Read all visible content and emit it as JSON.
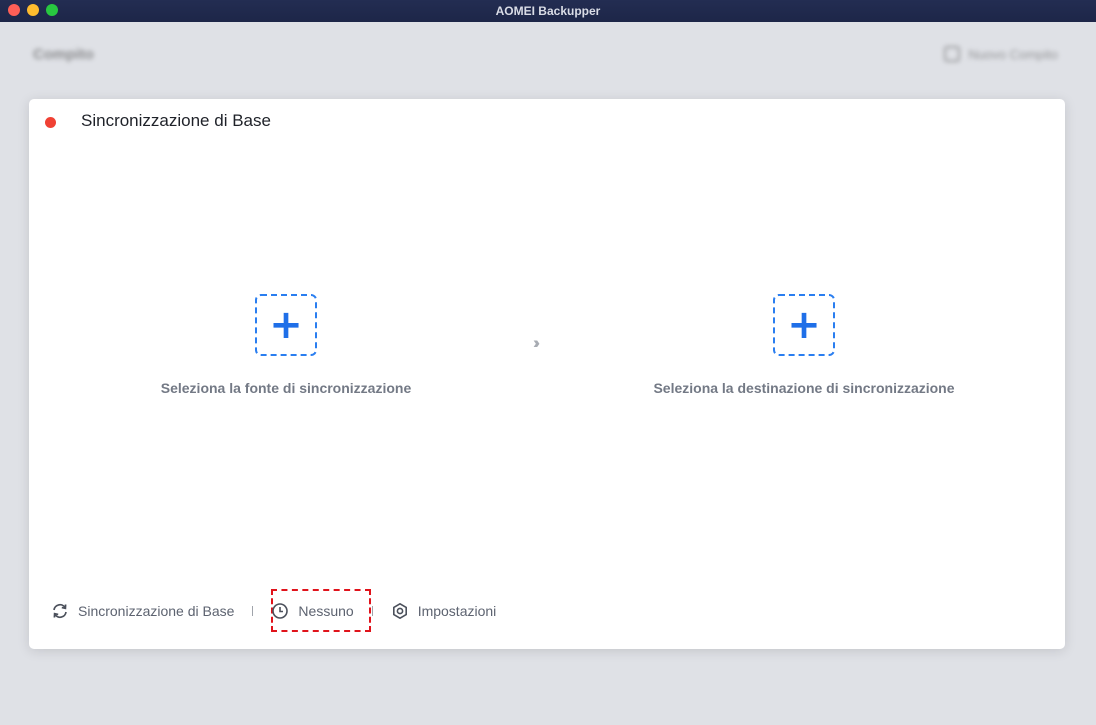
{
  "window": {
    "title": "AOMEI Backupper"
  },
  "background": {
    "page_title": "Compito",
    "reset_label": "Nuovo Compito"
  },
  "card": {
    "title": "Sincronizzazione di Base",
    "status_color": "#f04134"
  },
  "source": {
    "label": "Seleziona la fonte di sincronizzazione",
    "icon": "plus-icon"
  },
  "destination": {
    "label": "Seleziona la destinazione di sincronizzazione",
    "icon": "plus-icon"
  },
  "arrows": "›››",
  "toolbar": {
    "mode": {
      "label": "Sincronizzazione di Base",
      "icon": "sync-icon"
    },
    "schedule": {
      "label": "Nessuno",
      "icon": "clock-icon"
    },
    "settings": {
      "label": "Impostazioni",
      "icon": "gear-icon"
    }
  },
  "colors": {
    "accent": "#2a7ef0",
    "highlight": "#e0131b",
    "titlebar": "#232d52"
  }
}
